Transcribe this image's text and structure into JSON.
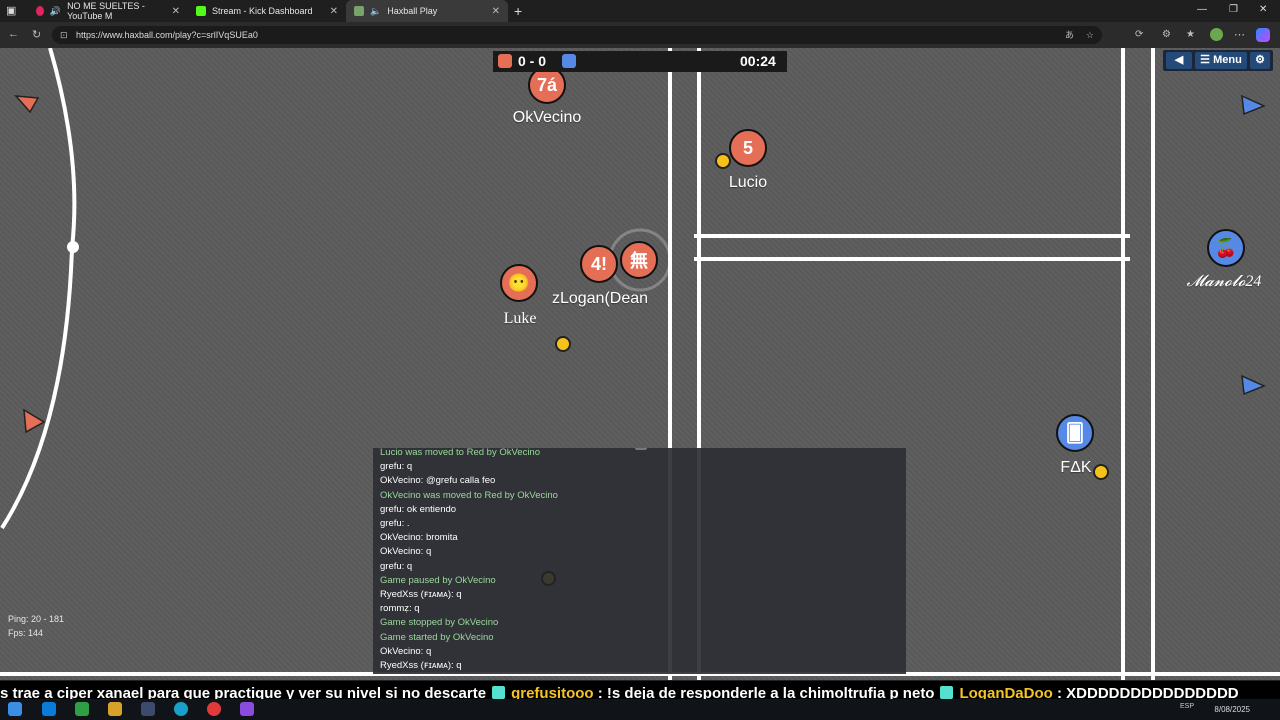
{
  "browser": {
    "tabs": [
      {
        "label": "NO ME SUELTES - YouTube M",
        "icon": "youtube-icon",
        "color": "#e0245e",
        "active": false
      },
      {
        "label": "Stream - Kick Dashboard",
        "icon": "kick-icon",
        "color": "#53fc18",
        "active": false
      },
      {
        "label": "Haxball Play",
        "icon": "haxball-icon",
        "color": "#7aa36a",
        "active": true
      }
    ],
    "url": "https://www.haxball.com/play?c=srlIVqSUEa0"
  },
  "scoreboard": {
    "score": "0 - 0",
    "time": "00:24",
    "red_color": "#e56e56",
    "blue_color": "#5689e5"
  },
  "menu": {
    "label": "Menu"
  },
  "players": [
    {
      "name": "OkVecino",
      "avatar": "7á",
      "team": "red"
    },
    {
      "name": "Lucio",
      "avatar": "5",
      "team": "red"
    },
    {
      "name": "zLogan(Dean",
      "avatar": "4!",
      "team": "red"
    },
    {
      "name": "",
      "avatar": "無",
      "team": "red"
    },
    {
      "name": "Luke",
      "avatar": "😶",
      "team": "red"
    },
    {
      "name": "𝓜𝓪𝓷𝓸𝓵𝓸24",
      "avatar": "🍒",
      "team": "blue"
    },
    {
      "name": "FΔK",
      "avatar": "🂠",
      "team": "blue"
    }
  ],
  "chat": [
    {
      "text": "Lucio was moved to Red by OkVecino",
      "sys": true
    },
    {
      "text": "grefu: q",
      "sys": false
    },
    {
      "text": "OkVecino: @grefu calla feo",
      "sys": false
    },
    {
      "text": "OkVecino was moved to Red by OkVecino",
      "sys": true
    },
    {
      "text": "grefu: ok entiendo",
      "sys": false
    },
    {
      "text": "grefu: .",
      "sys": false
    },
    {
      "text": "OkVecino: bromita",
      "sys": false
    },
    {
      "text": "OkVecino: q",
      "sys": false
    },
    {
      "text": "grefu: q",
      "sys": false
    },
    {
      "text": "Game paused by OkVecino",
      "sys": true
    },
    {
      "text": "RyedXss (ꜰɪᴀᴍᴀ): q",
      "sys": false
    },
    {
      "text": "rommẓ: q",
      "sys": false
    },
    {
      "text": "Game stopped by OkVecino",
      "sys": true
    },
    {
      "text": "Game started by OkVecino",
      "sys": true
    },
    {
      "text": "OkVecino: q",
      "sys": false
    },
    {
      "text": "RyedXss (ꜰɪᴀᴍᴀ): q",
      "sys": false
    }
  ],
  "stats": {
    "ping": "Ping: 20 - 181",
    "fps": "Fps: 144"
  },
  "ticker": {
    "part1": "s trae a ciper xanael para que practique y ver su nivel si no descarte",
    "user1": "grefusitooo",
    "msg1": ": !s deja de responderle a la chimoltrufia p neto",
    "user2": "LoganDaDoo",
    "msg2": ": XDDDDDDDDDDDDDDD"
  },
  "taskbar": {
    "lang": "ESP",
    "date": "8/08/2025"
  }
}
